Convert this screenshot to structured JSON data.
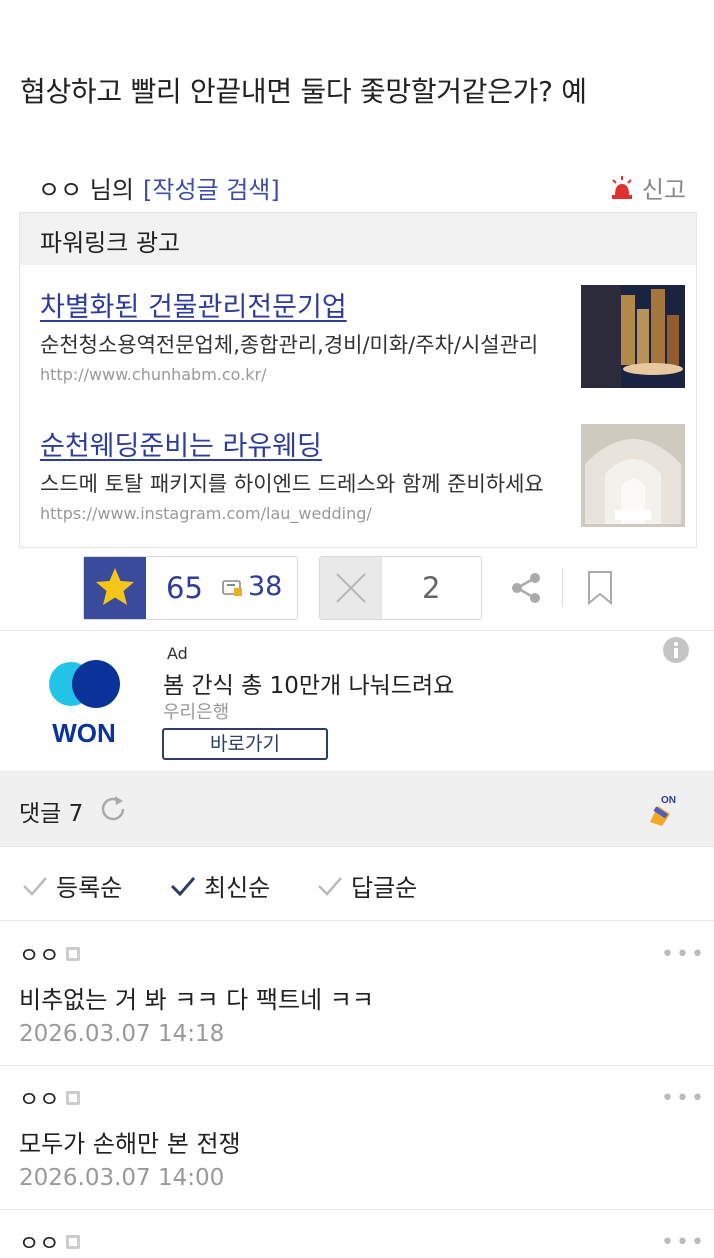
{
  "post": {
    "last_line": "협상하고 빨리 안끝내면 둘다 좇망할거같은가? 예"
  },
  "author_bar": {
    "name": "ㅇㅇ 님의",
    "search_link": "[작성글 검색]",
    "report": "신고"
  },
  "powerlink": {
    "header": "파워링크 광고",
    "items": [
      {
        "title": "차별화된 건물관리전문기업",
        "desc": "순천청소용역전문업체,종합관리,경비/미화/주차/시설관리",
        "url": "http://www.chunhabm.co.kr/"
      },
      {
        "title": "순천웨딩준비는 라유웨딩",
        "desc": "스드메 토탈 패키지를 하이엔드 드레스와 함께 준비하세요",
        "url": "https://www.instagram.com/lau_wedding/"
      }
    ]
  },
  "votes": {
    "up": "65",
    "scrap": "38",
    "down": "2"
  },
  "banner_ad": {
    "label": "Ad",
    "title": "봄 간식 총 10만개 나눠드려요",
    "sponsor": "우리은행",
    "button": "바로가기",
    "logo_text": "WON"
  },
  "comments_header": {
    "title": "댓글 7"
  },
  "sort": {
    "options": [
      "등록순",
      "최신순",
      "답글순"
    ],
    "active": "최신순"
  },
  "comments": [
    {
      "author": "ㅇㅇ",
      "text": "비추없는 거 봐 ㅋㅋ 다 팩트네 ㅋㅋ",
      "date": "2026.03.07 14:18"
    },
    {
      "author": "ㅇㅇ",
      "text": "모두가 손해만 본 전쟁",
      "date": "2026.03.07 14:00"
    },
    {
      "author": "ㅇㅇ",
      "text": "",
      "date": ""
    }
  ],
  "more_glyph": "•••",
  "colors": {
    "accent": "#2d3d99",
    "star_bg": "#3a4b9c",
    "star": "#f5c518",
    "report_red": "#e03030"
  }
}
